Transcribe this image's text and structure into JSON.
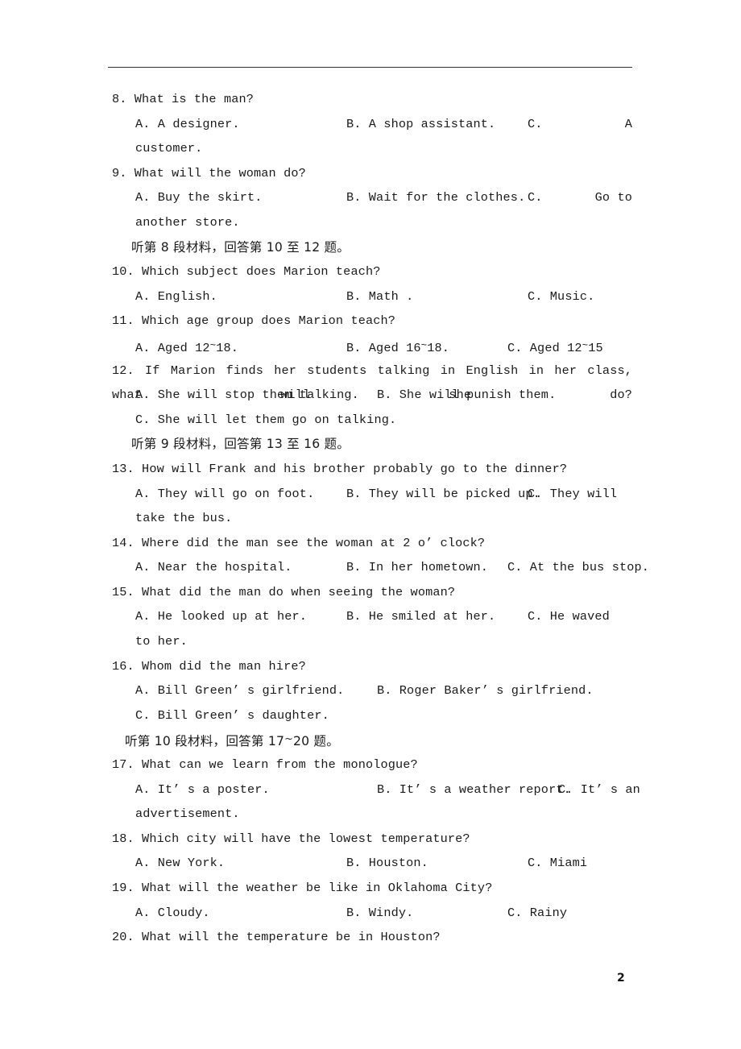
{
  "document": {
    "page_number": "2",
    "top_rule": true
  },
  "questions": [
    {
      "id": "q8",
      "number": "8.",
      "stem": "8.  What is the man?",
      "options_row": {
        "a": "A. A designer.",
        "b": "B. A shop assistant.",
        "c": "C.",
        "c_overflow": "A"
      },
      "continuation": "customer."
    },
    {
      "id": "q9",
      "number": "9.",
      "stem": "9.  What will the woman do?",
      "options_row": {
        "a": "A. Buy the skirt.",
        "b": "B. Wait for the clothes.",
        "c": "C.",
        "c_overflow": "Go   to"
      },
      "continuation": "another store."
    }
  ],
  "directions": [
    {
      "id": "dir8",
      "text": "听第 8 段材料，回答第 10 至 12 题。"
    },
    {
      "id": "dir9",
      "text": "听第 9 段材料，回答第 13 至 16 题。"
    },
    {
      "id": "dir10",
      "prefix": "听第 10 段材料，回答第 17",
      "tilde": "~",
      "suffix": "20 题。"
    }
  ],
  "q10": {
    "stem": "10.  Which subject does Marion teach?",
    "a": "A. English.",
    "b": "B. Math .",
    "c": "C. Music."
  },
  "q11": {
    "stem": "11.  Which age group does Marion teach?",
    "a_pre": "A. Aged 12",
    "a_tilde": "~",
    "a_post": "18.",
    "b_pre": "B. Aged 16",
    "b_tilde": "~",
    "b_post": "18.",
    "c_pre": "C. Aged 12",
    "c_tilde": "~",
    "c_post": "15"
  },
  "q12": {
    "stem": "12.  If Marion finds her students talking in English in her class, what will she do?",
    "a": "A. She will stop them talking.",
    "b": "B. She will punish them.",
    "c": "C. She will let them go on talking."
  },
  "q13": {
    "stem": "13.  How will Frank and his brother probably go to the dinner?",
    "a": "A. They will go on foot.",
    "b": "B. They will be picked up.",
    "c": "C. They will",
    "continuation": "take the bus."
  },
  "q14": {
    "stem": "14.  Where did the man see the woman at 2 o’ clock?",
    "a": "A. Near the hospital.",
    "b": "B. In her hometown.",
    "c": "C. At the bus stop."
  },
  "q15": {
    "stem": "15.  What did the man do when seeing the woman?",
    "a": "A. He looked up at her.",
    "b": "B. He smiled at her.",
    "c": "C. He waved",
    "continuation": "to her."
  },
  "q16": {
    "stem": "16.  Whom did the man hire?",
    "a": "A. Bill Green’ s girlfriend.",
    "b": "B. Roger Baker’ s girlfriend.",
    "c": "C. Bill Green’ s daughter."
  },
  "q17": {
    "stem": "17.  What can we learn from the monologue?",
    "a": "A. It’ s a poster.",
    "b": "B. It’ s a weather report.",
    "c": "C. It’ s an",
    "continuation": "advertisement."
  },
  "q18": {
    "stem": "18.  Which city will have the lowest temperature?",
    "a": "A. New York.",
    "b": "B. Houston.",
    "c": "C. Miami"
  },
  "q19": {
    "stem": "19.  What will the weather be like in Oklahoma City?",
    "a": "A. Cloudy.",
    "b": "B. Windy.",
    "c": "C. Rainy"
  },
  "q20": {
    "stem": "20.  What will the temperature be in Houston?"
  }
}
